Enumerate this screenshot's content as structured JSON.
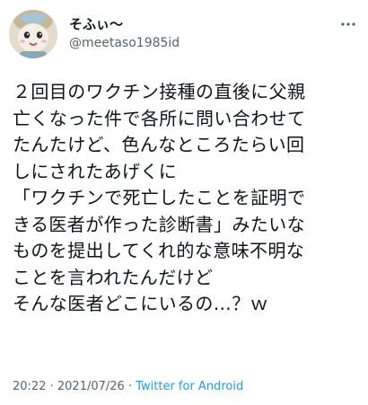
{
  "author": {
    "display_name": "そふぃ〜",
    "handle": "@meetaso1985id",
    "avatar_icon": "doll-avatar-icon"
  },
  "tweet": {
    "lines": [
      "２回目のワクチン接種の直後に父親",
      "亡くなった件で各所に問い合わせて",
      "たんたけど、色んなところたらい回",
      "しにされたあげくに",
      "「ワクチンで死亡したことを証明で",
      "きる医者が作った診断書」みたいな",
      "ものを提出してくれ的な意味不明な",
      "ことを言われたんだけど",
      "そんな医者どこにいるの…？ｗ"
    ]
  },
  "meta": {
    "time": "20:22",
    "separator": " · ",
    "date": "2021/07/26",
    "source": "Twitter for Android"
  },
  "icons": {
    "more": "more-options-icon"
  },
  "colors": {
    "text": "#0f1419",
    "secondary": "#536471",
    "link": "#1d9bf0"
  }
}
